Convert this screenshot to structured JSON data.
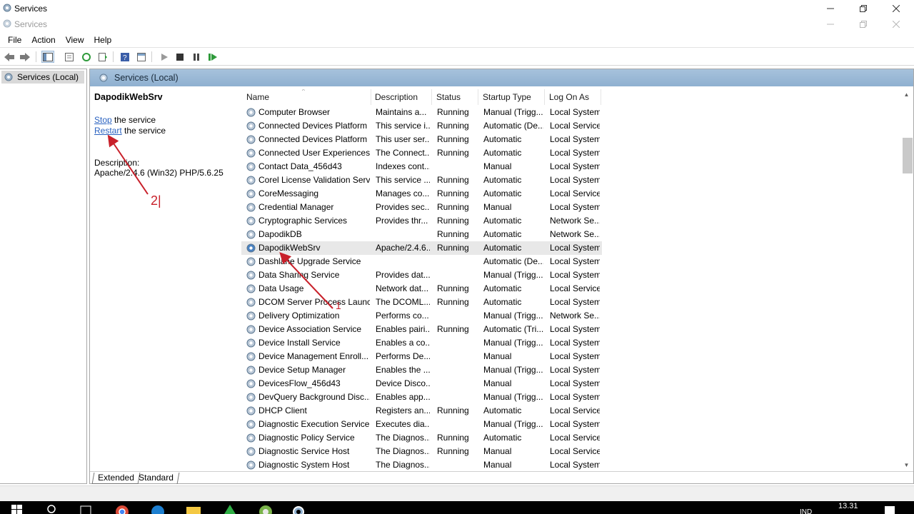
{
  "window": {
    "title": "Services",
    "inner_title": "Services"
  },
  "menu": [
    "File",
    "Action",
    "View",
    "Help"
  ],
  "tree": {
    "root_label": "Services (Local)"
  },
  "main": {
    "header_title": "Services (Local)",
    "detail": {
      "service_name": "DapodikWebSrv",
      "stop_link": "Stop",
      "stop_suffix": " the service",
      "restart_link": "Restart",
      "restart_suffix": " the service",
      "description_label": "Description:",
      "description_text": "Apache/2.4.6 (Win32) PHP/5.6.25"
    },
    "columns": {
      "name": "Name",
      "description": "Description",
      "status": "Status",
      "startup": "Startup Type",
      "logon": "Log On As"
    },
    "rows": [
      {
        "name": "Computer Browser",
        "desc": "Maintains a...",
        "status": "Running",
        "startup": "Manual (Trigg...",
        "logon": "Local System"
      },
      {
        "name": "Connected Devices Platform ...",
        "desc": "This service i...",
        "status": "Running",
        "startup": "Automatic (De...",
        "logon": "Local Service"
      },
      {
        "name": "Connected Devices Platform ...",
        "desc": "This user ser...",
        "status": "Running",
        "startup": "Automatic",
        "logon": "Local System"
      },
      {
        "name": "Connected User Experiences ...",
        "desc": "The Connect...",
        "status": "Running",
        "startup": "Automatic",
        "logon": "Local System"
      },
      {
        "name": "Contact Data_456d43",
        "desc": "Indexes cont...",
        "status": "",
        "startup": "Manual",
        "logon": "Local System"
      },
      {
        "name": "Corel License Validation Serv...",
        "desc": "This service ...",
        "status": "Running",
        "startup": "Automatic",
        "logon": "Local System"
      },
      {
        "name": "CoreMessaging",
        "desc": "Manages co...",
        "status": "Running",
        "startup": "Automatic",
        "logon": "Local Service"
      },
      {
        "name": "Credential Manager",
        "desc": "Provides sec...",
        "status": "Running",
        "startup": "Manual",
        "logon": "Local System"
      },
      {
        "name": "Cryptographic Services",
        "desc": "Provides thr...",
        "status": "Running",
        "startup": "Automatic",
        "logon": "Network Se..."
      },
      {
        "name": "DapodikDB",
        "desc": "",
        "status": "Running",
        "startup": "Automatic",
        "logon": "Network Se..."
      },
      {
        "name": "DapodikWebSrv",
        "desc": "Apache/2.4.6...",
        "status": "Running",
        "startup": "Automatic",
        "logon": "Local System"
      },
      {
        "name": "Dashlane Upgrade Service",
        "desc": "",
        "status": "",
        "startup": "Automatic (De...",
        "logon": "Local System"
      },
      {
        "name": "Data Sharing Service",
        "desc": "Provides dat...",
        "status": "",
        "startup": "Manual (Trigg...",
        "logon": "Local System"
      },
      {
        "name": "Data Usage",
        "desc": "Network dat...",
        "status": "Running",
        "startup": "Automatic",
        "logon": "Local Service"
      },
      {
        "name": "DCOM Server Process Launc...",
        "desc": "The DCOML...",
        "status": "Running",
        "startup": "Automatic",
        "logon": "Local System"
      },
      {
        "name": "Delivery Optimization",
        "desc": "Performs co...",
        "status": "",
        "startup": "Manual (Trigg...",
        "logon": "Network Se..."
      },
      {
        "name": "Device Association Service",
        "desc": "Enables pairi...",
        "status": "Running",
        "startup": "Automatic (Tri...",
        "logon": "Local System"
      },
      {
        "name": "Device Install Service",
        "desc": "Enables a co...",
        "status": "",
        "startup": "Manual (Trigg...",
        "logon": "Local System"
      },
      {
        "name": "Device Management Enroll...",
        "desc": "Performs De...",
        "status": "",
        "startup": "Manual",
        "logon": "Local System"
      },
      {
        "name": "Device Setup Manager",
        "desc": "Enables the ...",
        "status": "",
        "startup": "Manual (Trigg...",
        "logon": "Local System"
      },
      {
        "name": "DevicesFlow_456d43",
        "desc": "Device Disco...",
        "status": "",
        "startup": "Manual",
        "logon": "Local System"
      },
      {
        "name": "DevQuery Background Disc...",
        "desc": "Enables app...",
        "status": "",
        "startup": "Manual (Trigg...",
        "logon": "Local System"
      },
      {
        "name": "DHCP Client",
        "desc": "Registers an...",
        "status": "Running",
        "startup": "Automatic",
        "logon": "Local Service"
      },
      {
        "name": "Diagnostic Execution Service",
        "desc": "Executes dia...",
        "status": "",
        "startup": "Manual (Trigg...",
        "logon": "Local System"
      },
      {
        "name": "Diagnostic Policy Service",
        "desc": "The Diagnos...",
        "status": "Running",
        "startup": "Automatic",
        "logon": "Local Service"
      },
      {
        "name": "Diagnostic Service Host",
        "desc": "The Diagnos...",
        "status": "Running",
        "startup": "Manual",
        "logon": "Local Service"
      },
      {
        "name": "Diagnostic System Host",
        "desc": "The Diagnos...",
        "status": "",
        "startup": "Manual",
        "logon": "Local System"
      }
    ],
    "selected_row": "DapodikWebSrv"
  },
  "tabs": [
    "Extended",
    "Standard"
  ],
  "annotations": {
    "label_1": "1",
    "label_2": "2|"
  },
  "taskbar": {
    "clock": "13.31",
    "language": "IND"
  },
  "colors": {
    "header_bar": "#9db9d6",
    "link": "#2a62c0",
    "annotation": "#c8202a"
  },
  "icons": [
    "service-gear-icon",
    "back-arrow-icon",
    "forward-arrow-icon",
    "play-icon",
    "stop-icon",
    "pause-icon",
    "resume-icon",
    "help-icon"
  ]
}
